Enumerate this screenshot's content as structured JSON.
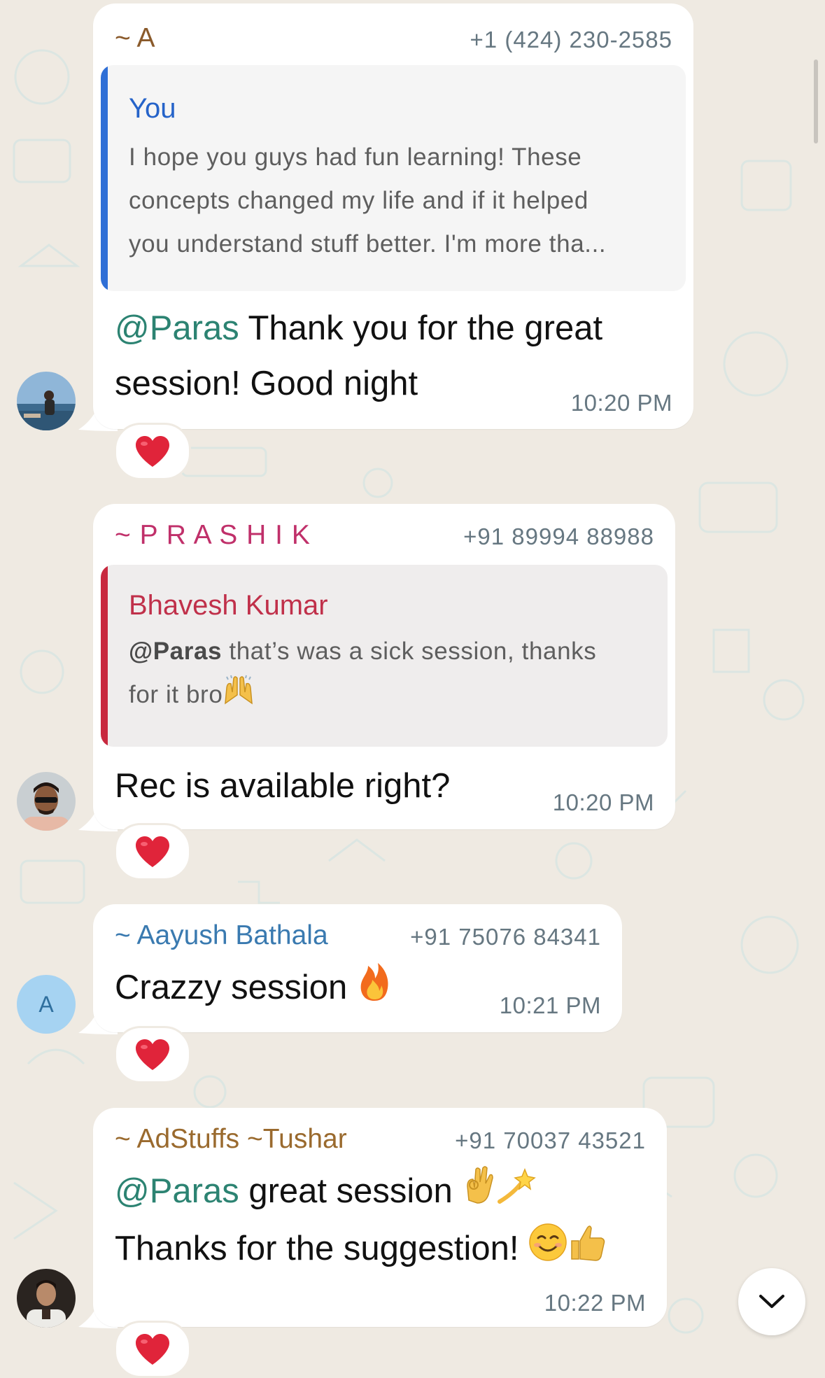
{
  "messages": [
    {
      "sender": "~ A",
      "sender_color": "#8a5a2b",
      "phone": "+1 (424) 230-2585",
      "quote": {
        "name": "You",
        "name_color": "#2563c9",
        "bar_color": "#2f6fd6",
        "lines": [
          "I hope you guys had fun learning! These",
          "concepts changed my life and if it helped",
          "you understand stuff better. I'm more tha..."
        ]
      },
      "mention": "@Paras",
      "text_line1": " Thank you for the great",
      "text_line2": "session! Good night",
      "time": "10:20 PM",
      "reaction": "heart",
      "avatar": "photo-beach"
    },
    {
      "sender": "~ P R A S H I K",
      "sender_color": "#c0306a",
      "phone": "+91 89994 88988",
      "quote": {
        "name": "Bhavesh Kumar",
        "name_color": "#c0304a",
        "bar_color": "#c8293f",
        "mention": "@Paras",
        "line1_rest": " that’s was a sick session, thanks",
        "line2": "for it bro",
        "line2_emoji": "raising-hands-emoji"
      },
      "text": "Rec is available right?",
      "time": "10:20 PM",
      "reaction": "heart",
      "avatar": "photo-man-sunglasses"
    },
    {
      "sender": "~ Aayush Bathala",
      "sender_color": "#3a7ab0",
      "phone": "+91 75076 84341",
      "text": "Crazzy session ",
      "text_emoji": "fire-emoji",
      "time": "10:21 PM",
      "reaction": "heart",
      "avatar_initial": "A",
      "avatar_color": "#a6d3f2"
    },
    {
      "sender": "~ AdStuffs ~Tushar",
      "sender_color": "#9a6a2e",
      "phone": "+91 70037 43521",
      "mention": "@Paras",
      "text_line1": " great session ",
      "line1_emojis": [
        "ok-hand-emoji",
        "dizzy-emoji"
      ],
      "text_line2": "Thanks for the suggestion! ",
      "line2_emojis": [
        "smiling-face-emoji",
        "thumbs-up-emoji"
      ],
      "time": "10:22 PM",
      "reaction": "heart",
      "avatar": "photo-man-white-jacket"
    }
  ],
  "colors": {
    "background": "#efeae2",
    "bubble": "#ffffff",
    "mention": "#2c8372",
    "timestamp": "#667781"
  },
  "scroll_button_icon": "chevron-down-icon"
}
